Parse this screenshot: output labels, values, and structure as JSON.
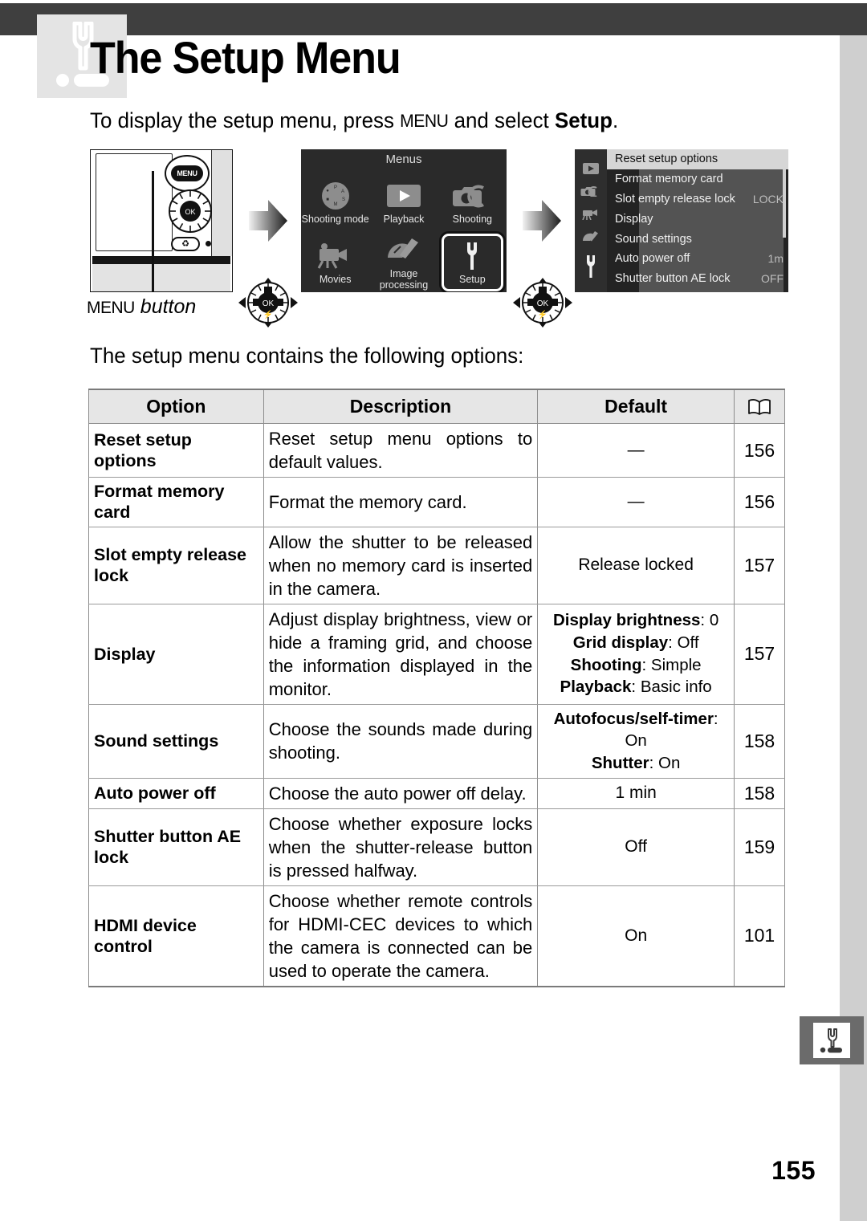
{
  "page": {
    "title": "The Setup Menu",
    "number": "155",
    "badge_icon": "wrench-icon",
    "corner_tab_icon": "wrench-icon"
  },
  "intro": {
    "before": "To display the setup menu, press ",
    "menu_key": "MENU",
    "middle": " and select ",
    "target": "Setup",
    "after": "."
  },
  "figure": {
    "camera": {
      "menu_button_cap": "MENU",
      "trash_icon": "trash-icon",
      "callout_menu_key": "MENU",
      "callout_word": "button"
    },
    "arrow_icon": "right-arrow-icon",
    "menus_screen": {
      "title": "Menus",
      "items": [
        {
          "label": "Shooting mode",
          "icon": "mode-dial-icon",
          "selected": false
        },
        {
          "label": "Playback",
          "icon": "play-icon",
          "selected": false
        },
        {
          "label": "Shooting",
          "icon": "camera-icon",
          "selected": false
        },
        {
          "label": "Movies",
          "icon": "movie-camera-icon",
          "selected": false
        },
        {
          "label": "Image processing",
          "icon": "palette-brush-icon",
          "selected": false
        },
        {
          "label": "Setup",
          "icon": "wrench-icon",
          "selected": true
        }
      ]
    },
    "setup_screen": {
      "side_icons": [
        "play-icon",
        "camera-icon",
        "movie-camera-icon",
        "palette-brush-icon",
        "wrench-icon"
      ],
      "rows": [
        {
          "label": "Reset setup options",
          "value": "",
          "highlighted": true
        },
        {
          "label": "Format memory card",
          "value": "",
          "highlighted": false
        },
        {
          "label": "Slot empty release lock",
          "value": "LOCK",
          "highlighted": false
        },
        {
          "label": "Display",
          "value": "",
          "highlighted": false
        },
        {
          "label": "Sound settings",
          "value": "",
          "highlighted": false
        },
        {
          "label": "Auto power off",
          "value": "1m",
          "highlighted": false
        },
        {
          "label": "Shutter button AE lock",
          "value": "OFF",
          "highlighted": false
        }
      ]
    }
  },
  "subhead": "The setup menu contains the following options:",
  "table": {
    "headers": {
      "option": "Option",
      "description": "Description",
      "default": "Default",
      "page": "book-icon"
    },
    "rows": [
      {
        "option": "Reset setup options",
        "description": "Reset setup menu options to default values.",
        "default": "—",
        "page": "156"
      },
      {
        "option": "Format memory card",
        "description": "Format the memory card.",
        "default": "—",
        "page": "156"
      },
      {
        "option": "Slot empty release lock",
        "description": "Allow the shutter to be released when no memory card is inserted in the camera.",
        "default": "Release locked",
        "page": "157"
      },
      {
        "option": "Display",
        "description": "Adjust display brightness, view or hide a framing grid, and choose the information displayed in the monitor.",
        "default_pairs": [
          {
            "key": "Display brightness",
            "value": "0"
          },
          {
            "key": "Grid display",
            "value": "Off"
          },
          {
            "key": "Shooting",
            "value": "Simple"
          },
          {
            "key": "Playback",
            "value": "Basic info"
          }
        ],
        "page": "157"
      },
      {
        "option": "Sound settings",
        "description": "Choose the sounds made during shooting.",
        "default_pairs": [
          {
            "key": "Autofocus/self-timer",
            "value": "On"
          },
          {
            "key": "Shutter",
            "value": "On"
          }
        ],
        "page": "158"
      },
      {
        "option": "Auto power off",
        "description": "Choose the auto power off delay.",
        "default": "1 min",
        "page": "158"
      },
      {
        "option": "Shutter button AE lock",
        "description": "Choose whether exposure locks when the shutter-release button is pressed halfway.",
        "default": "Off",
        "page": "159"
      },
      {
        "option": "HDMI device control",
        "description": "Choose whether remote controls for HDMI-CEC devices to which the camera is connected can be used to operate the camera.",
        "default": "On",
        "page": "101"
      }
    ]
  },
  "colors": {
    "header_bar": "#3f3f3f",
    "margin_bar": "#cfcfcf",
    "badge_bg": "#e4e4e4",
    "table_header_bg": "#e6e6e6",
    "screen_bg": "#2a2a2a",
    "highlight_bg": "#d6d6d6"
  }
}
